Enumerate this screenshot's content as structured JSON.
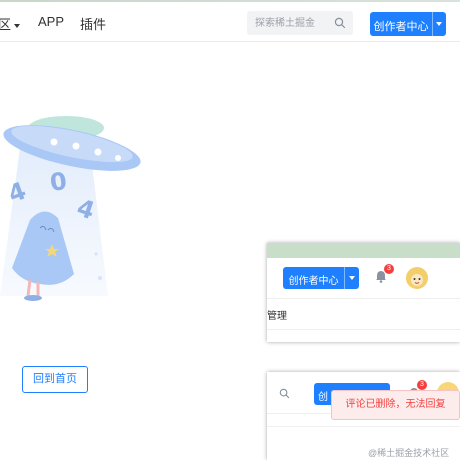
{
  "nav": {
    "items": [
      {
        "label": "区",
        "has_dropdown": true
      },
      {
        "label": "APP"
      },
      {
        "label": "插件"
      }
    ],
    "search": {
      "placeholder": "探索稀土掘金",
      "icon": "search-icon"
    },
    "creator_button": {
      "label": "创作者中心",
      "icon": "chevron-down-icon"
    }
  },
  "illustration": {
    "text": "404",
    "icon": "ufo-404-illustration"
  },
  "home_button": {
    "label": "回到首页"
  },
  "screenshot_top": {
    "creator_button": {
      "label": "创作者中心"
    },
    "notification_count": "3",
    "menu_text": "管理"
  },
  "screenshot_bottom": {
    "creator_button": {
      "label": "创"
    },
    "notification_count": "3",
    "toast": "评论已删除，无法回复"
  },
  "watermark": "@稀土掘金技术社区",
  "colors": {
    "accent": "#1e80ff",
    "error": "#f53f3f",
    "illustration": "#a9c8f5"
  }
}
